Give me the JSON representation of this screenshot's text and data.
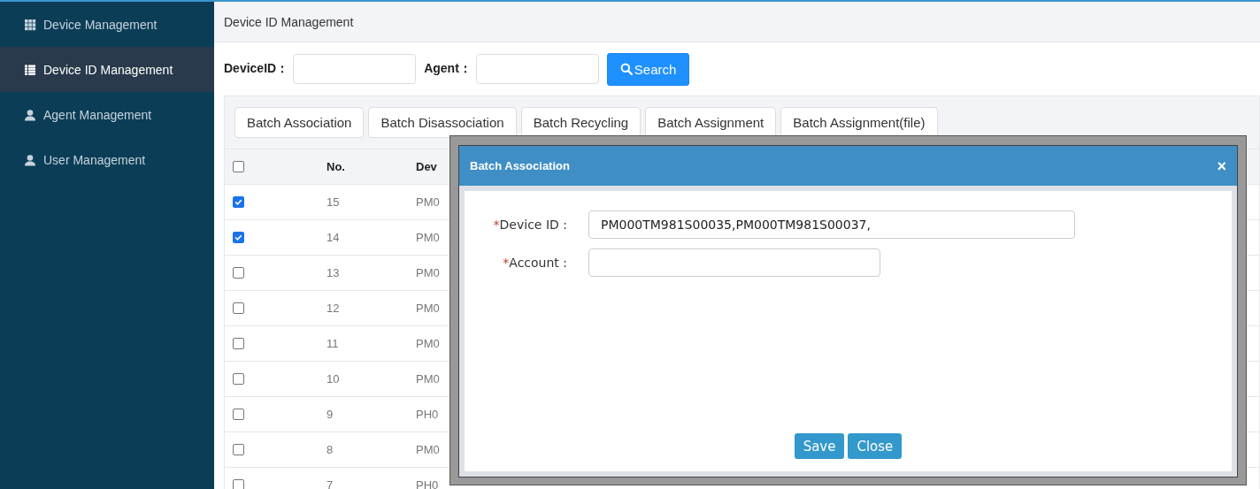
{
  "sidebar": {
    "items": [
      {
        "label": "Device Management",
        "selected": false
      },
      {
        "label": "Device ID Management",
        "selected": true
      },
      {
        "label": "Agent Management",
        "selected": false
      },
      {
        "label": "User Management",
        "selected": false
      }
    ]
  },
  "page_title": "Device ID Management",
  "search": {
    "fields": [
      {
        "label": "DeviceID："
      },
      {
        "label": "Agent："
      }
    ],
    "button": "Search"
  },
  "toolbar": {
    "buttons": [
      "Batch Association",
      "Batch Disassociation",
      "Batch Recycling",
      "Batch Assignment",
      "Batch Assignment(file)"
    ]
  },
  "table": {
    "select_all": {
      "checked": false
    },
    "columns": [
      "No.",
      "Dev"
    ],
    "rows": [
      {
        "checked": true,
        "no": "15",
        "device": "PM0"
      },
      {
        "checked": true,
        "no": "14",
        "device": "PM0"
      },
      {
        "checked": false,
        "no": "13",
        "device": "PM0"
      },
      {
        "checked": false,
        "no": "12",
        "device": "PM0"
      },
      {
        "checked": false,
        "no": "11",
        "device": "PM0"
      },
      {
        "checked": false,
        "no": "10",
        "device": "PM0"
      },
      {
        "checked": false,
        "no": "9",
        "device": "PH0"
      },
      {
        "checked": false,
        "no": "8",
        "device": "PM0"
      },
      {
        "checked": false,
        "no": "7",
        "device": "PH0"
      }
    ]
  },
  "modal": {
    "title": "Batch Association",
    "close": "×",
    "fields": [
      {
        "required_mark": "*",
        "label": "Device ID :",
        "value": "PM000TM981S00035,PM000TM981S00037,"
      },
      {
        "required_mark": "*",
        "label": "Account :"
      }
    ],
    "buttons": [
      "Save",
      "Close"
    ]
  }
}
